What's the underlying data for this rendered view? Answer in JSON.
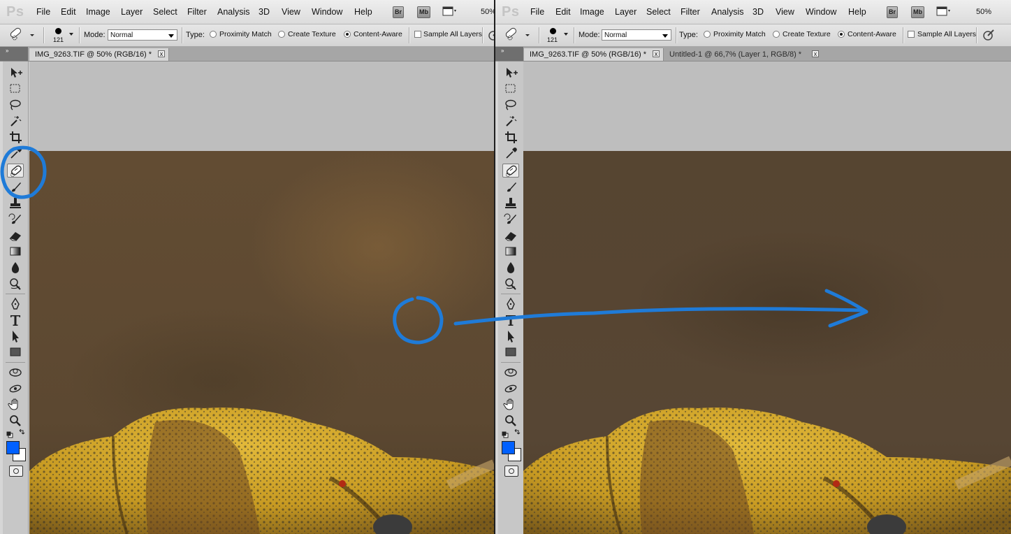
{
  "app": {
    "logo": "Ps"
  },
  "menus": [
    "File",
    "Edit",
    "Image",
    "Layer",
    "Select",
    "Filter",
    "Analysis",
    "3D",
    "View",
    "Window",
    "Help"
  ],
  "appbar": {
    "bridge": "Br",
    "minibridge": "Mb"
  },
  "left": {
    "zoom": "50%"
  },
  "right": {
    "zoom": "50%"
  },
  "options": {
    "brush_size": "121",
    "mode_label": "Mode:",
    "mode_value": "Normal",
    "type_label": "Type:",
    "proximity": "Proximity Match",
    "create_texture": "Create Texture",
    "content_aware": "Content-Aware",
    "selected_type": "Content-Aware",
    "sample_all": "Sample All Layers"
  },
  "tabs_left": [
    {
      "label": "IMG_9263.TIF @ 50% (RGB/16) *",
      "active": true
    }
  ],
  "tabs_right": [
    {
      "label": "IMG_9263.TIF @ 50% (RGB/16) *",
      "active": true
    },
    {
      "label": "Untitled-1 @ 66,7% (Layer 1, RGB/8) *",
      "active": false
    }
  ],
  "tools": [
    "move",
    "marquee",
    "lasso",
    "quick-select",
    "crop",
    "eyedropper",
    "spot-healing-brush",
    "brush",
    "clone-stamp",
    "history-brush",
    "eraser",
    "gradient",
    "blur",
    "dodge",
    "pen",
    "type",
    "path-select",
    "rectangle",
    "3d-rotate",
    "3d-orbit",
    "hand",
    "zoom"
  ],
  "active_tool": "spot-healing-brush",
  "colors": {
    "foreground": "#0060ff",
    "background": "#ffffff",
    "annotation": "#1f7bd8"
  },
  "tab_close_glyph": "x",
  "panel_grip_glyph": "»"
}
